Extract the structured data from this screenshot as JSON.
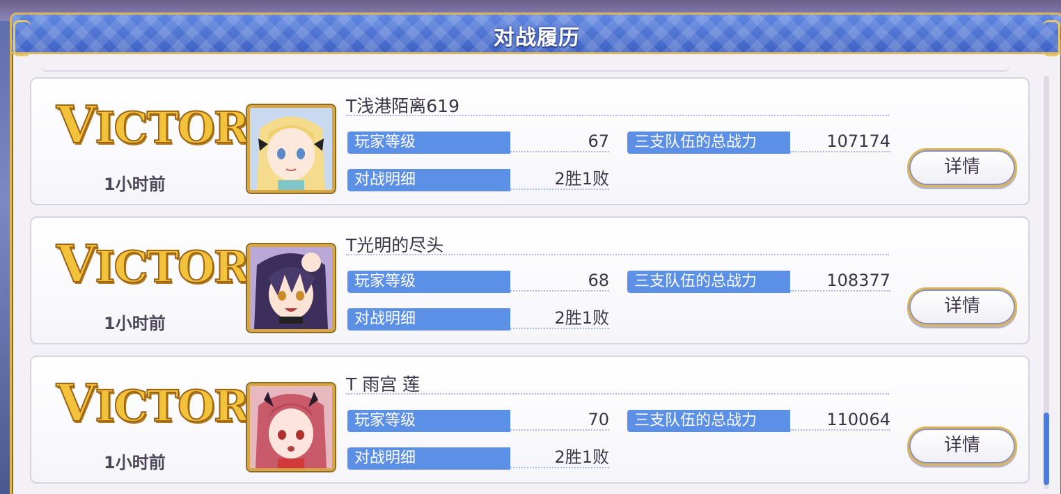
{
  "window": {
    "title": "对战履历"
  },
  "records": [
    {
      "result": "VICTORY",
      "time": "1小时前",
      "player_name": "T浅港陌离619",
      "level_label": "玩家等级",
      "level_value": "67",
      "battle_label": "对战明细",
      "battle_value": "2胜1败",
      "power_label": "三支队伍的总战力",
      "power_value": "107174",
      "detail_button": "详情",
      "avatar": "blonde-girl-portrait"
    },
    {
      "result": "VICTORY",
      "time": "1小时前",
      "player_name": "T光明的尽头",
      "level_label": "玩家等级",
      "level_value": "68",
      "battle_label": "对战明细",
      "battle_value": "2胜1败",
      "power_label": "三支队伍的总战力",
      "power_value": "108377",
      "detail_button": "详情",
      "avatar": "purple-haired-girl-portrait"
    },
    {
      "result": "VICTORY",
      "time": "1小时前",
      "player_name": "T 雨宫 莲",
      "level_label": "玩家等级",
      "level_value": "70",
      "battle_label": "对战明细",
      "battle_value": "2胜1败",
      "power_label": "三支队伍的总战力",
      "power_value": "110064",
      "detail_button": "详情",
      "avatar": "pink-haired-girl-portrait"
    }
  ],
  "colors": {
    "title_bar": "#4a70d2",
    "label_bg": "#5c8fe6",
    "gold": "#d9b45a",
    "victory": "#f2c23a",
    "scroll_thumb": "#4a7be0"
  }
}
